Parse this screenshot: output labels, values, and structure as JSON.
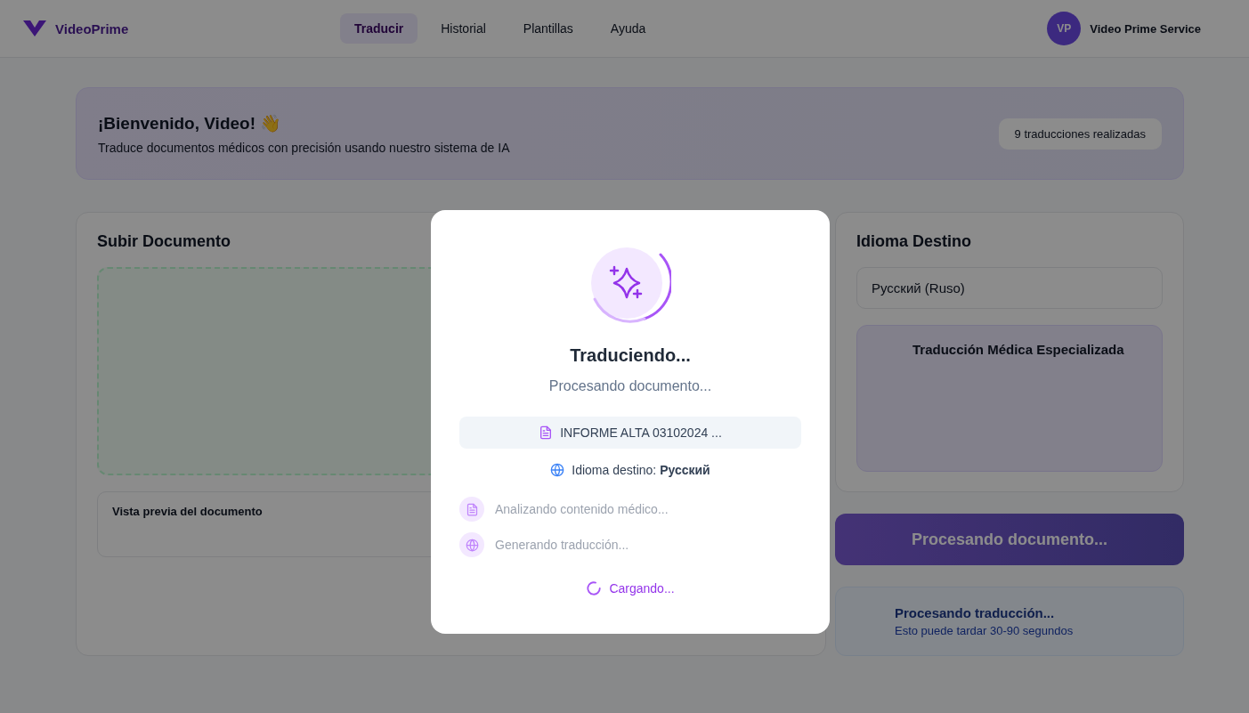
{
  "header": {
    "brand": "VideoPrime",
    "nav": [
      {
        "label": "Traducir",
        "selected": true
      },
      {
        "label": "Historial",
        "selected": false
      },
      {
        "label": "Plantillas",
        "selected": false
      },
      {
        "label": "Ayuda",
        "selected": false
      }
    ],
    "user": {
      "initials": "VP",
      "name": "Video Prime Service"
    }
  },
  "welcome": {
    "title": "¡Bienvenido, Video! 👋",
    "subtitle": "Traduce documentos médicos con precisión usando nuestro sistema de IA",
    "stat": "9 traducciones realizadas"
  },
  "upload": {
    "title": "Subir Documento",
    "preview_title": "Vista previa del documento"
  },
  "target": {
    "title": "Idioma Destino",
    "language": "Русский (Ruso)",
    "info_title": "Traducción Médica Especializada"
  },
  "process_button": "Procesando documento...",
  "status": {
    "title": "Procesando traducción...",
    "subtitle": "Esto puede tardar 30-90 segundos"
  },
  "modal": {
    "title": "Traduciendo...",
    "subtitle": "Procesando documento...",
    "file_name": "INFORME ALTA 03102024 ...",
    "target_label": "Idioma destino:",
    "target_language": "Русский",
    "steps": [
      {
        "kind": "document",
        "label": "Analizando contenido médico..."
      },
      {
        "kind": "globe",
        "label": "Generando traducción..."
      }
    ],
    "loading": "Cargando..."
  }
}
